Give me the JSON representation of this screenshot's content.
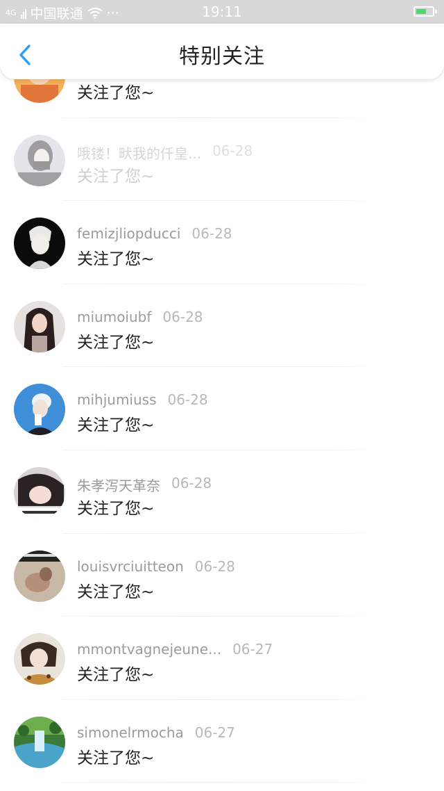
{
  "status_bar": {
    "signal": "4G",
    "carrier": "中国联通",
    "dots": "···",
    "time": "19:11"
  },
  "header": {
    "title": "特别关注",
    "back_icon": "chevron-left-icon"
  },
  "colors": {
    "accent": "#2a9df4",
    "battery": "#4cd964"
  },
  "list": {
    "items": [
      {
        "name": "",
        "date": "",
        "action": "关注了您~"
      },
      {
        "name": "哦镂！畎我的仟皇...",
        "date": "06-28",
        "action": "关注了您~"
      },
      {
        "name": "femizjliopducci",
        "date": "06-28",
        "action": "关注了您~"
      },
      {
        "name": "miumoiubf",
        "date": "06-28",
        "action": "关注了您~"
      },
      {
        "name": "mihjumiuss",
        "date": "06-28",
        "action": "关注了您~"
      },
      {
        "name": "朱孝泻天革奈",
        "date": "06-28",
        "action": "关注了您~"
      },
      {
        "name": "louisvrciuitteon",
        "date": "06-28",
        "action": "关注了您~"
      },
      {
        "name": "mmontvagnejeune...",
        "date": "06-27",
        "action": "关注了您~"
      },
      {
        "name": "simonelrmocha",
        "date": "06-27",
        "action": "关注了您~"
      }
    ]
  }
}
